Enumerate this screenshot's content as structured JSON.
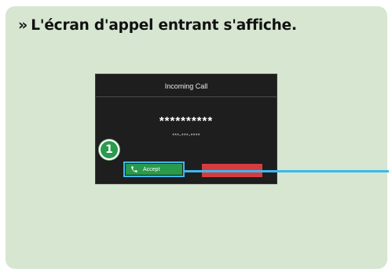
{
  "heading": {
    "chevron": "»",
    "text": "L'écran d'appel entrant s'affiche."
  },
  "screen": {
    "title": "Incoming Call",
    "caller_name": "**********",
    "caller_number": "***-***-****",
    "accept_label": "Accept",
    "accept_icon": "phone-icon",
    "decline_label": ""
  },
  "callout": {
    "number": "1"
  },
  "colors": {
    "panel_bg": "#d6e6d1",
    "screen_bg": "#1e1e1e",
    "accept": "#2a9a4c",
    "decline": "#d63c3f",
    "highlight": "#3db8ec"
  }
}
